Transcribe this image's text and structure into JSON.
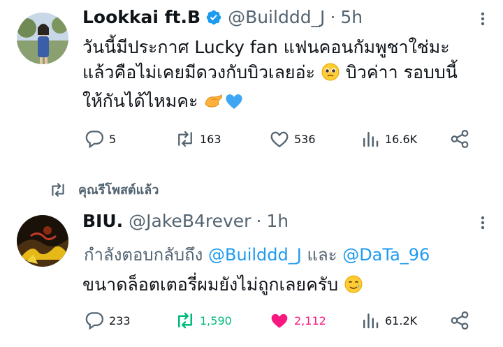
{
  "tweet1": {
    "name": "Lookkai ft.B",
    "handle": "@Builddd_J",
    "separator": "·",
    "time": "5h",
    "lines": [
      "วันนี้มีประกาศ Lucky fan แฟนคอนกัมพูชาใช่มะ",
      "แล้วคือไม่เคยมีดวงกับบิวเลยอ่ะ",
      "บิวค่าา รอบบนี้",
      "ให้กันได้ไหมคะ"
    ],
    "replies": "5",
    "reposts": "163",
    "likes": "536",
    "views": "16.6K",
    "icons": [
      "reply-icon",
      "repost-icon",
      "like-icon",
      "views-icon",
      "share-icon"
    ]
  },
  "repost_banner": {
    "text": "คุณรีโพสต์แล้ว"
  },
  "tweet2": {
    "name": "BIU.",
    "handle": "@JakeB4rever",
    "separator": "·",
    "time": "1h",
    "reply_prefix": "กำลังตอบกลับถึง",
    "mention1": "@Builddd_J",
    "reply_and": "และ",
    "mention2": "@DaTa_96",
    "text": "ขนาดล็อตเตอรี่ผมยังไม่ถูกเลยครับ",
    "replies": "233",
    "reposts": "1,590",
    "likes": "2,112",
    "views": "61.2K"
  },
  "colors": {
    "accent": "#1d9bf0",
    "muted": "#536471",
    "repost_active": "#00ba7c",
    "like_active": "#f91880"
  }
}
